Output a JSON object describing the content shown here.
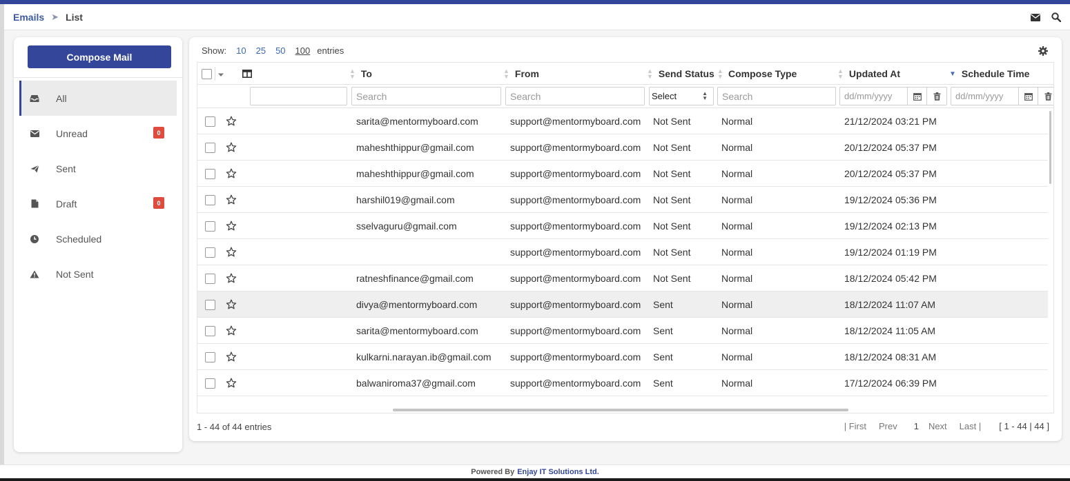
{
  "breadcrumb": {
    "root": "Emails",
    "separator": "➤",
    "current": "List"
  },
  "header_icons": [
    "envelope-icon",
    "search-icon"
  ],
  "sidebar": {
    "compose_label": "Compose Mail",
    "items": [
      {
        "label": "All",
        "icon": "inbox-tray-icon",
        "active": true
      },
      {
        "label": "Unread",
        "icon": "envelope-icon",
        "badge": "0"
      },
      {
        "label": "Sent",
        "icon": "paper-plane-icon"
      },
      {
        "label": "Draft",
        "icon": "document-icon",
        "badge": "0"
      },
      {
        "label": "Scheduled",
        "icon": "clock-icon"
      },
      {
        "label": "Not Sent",
        "icon": "warning-triangle-icon"
      }
    ]
  },
  "list": {
    "show_label": "Show:",
    "page_sizes": [
      "10",
      "25",
      "50",
      "100"
    ],
    "selected_page_size": "100",
    "entries_label": "entries",
    "columns": [
      "To",
      "From",
      "Send Status",
      "Compose Type",
      "Updated At",
      "Schedule Time"
    ],
    "filters": {
      "search_placeholder": "Search",
      "select_value": "Select",
      "date_placeholder": "dd/mm/yyyy"
    },
    "rows": [
      {
        "to": "sarita@mentormyboard.com",
        "from": "support@mentormyboard.com",
        "status": "Not Sent",
        "type": "Normal",
        "updated": "21/12/2024 03:21 PM"
      },
      {
        "to": "maheshthippur@gmail.com",
        "from": "support@mentormyboard.com",
        "status": "Not Sent",
        "type": "Normal",
        "updated": "20/12/2024 05:37 PM"
      },
      {
        "to": "maheshthippur@gmail.com",
        "from": "support@mentormyboard.com",
        "status": "Not Sent",
        "type": "Normal",
        "updated": "20/12/2024 05:37 PM"
      },
      {
        "to": "harshil019@gmail.com",
        "from": "support@mentormyboard.com",
        "status": "Not Sent",
        "type": "Normal",
        "updated": "19/12/2024 05:36 PM"
      },
      {
        "to": "sselvaguru@gmail.com",
        "from": "support@mentormyboard.com",
        "status": "Not Sent",
        "type": "Normal",
        "updated": "19/12/2024 02:13 PM"
      },
      {
        "to": "",
        "from": "support@mentormyboard.com",
        "status": "Not Sent",
        "type": "Normal",
        "updated": "19/12/2024 01:19 PM"
      },
      {
        "to": "ratneshfinance@gmail.com",
        "from": "support@mentormyboard.com",
        "status": "Not Sent",
        "type": "Normal",
        "updated": "18/12/2024 05:42 PM"
      },
      {
        "to": "divya@mentormyboard.com",
        "from": "support@mentormyboard.com",
        "status": "Sent",
        "type": "Normal",
        "updated": "18/12/2024 11:07 AM",
        "highlight": true
      },
      {
        "to": "sarita@mentormyboard.com",
        "from": "support@mentormyboard.com",
        "status": "Sent",
        "type": "Normal",
        "updated": "18/12/2024 11:05 AM"
      },
      {
        "to": "kulkarni.narayan.ib@gmail.com",
        "from": "support@mentormyboard.com",
        "status": "Sent",
        "type": "Normal",
        "updated": "18/12/2024 08:31 AM"
      },
      {
        "to": "balwaniroma37@gmail.com",
        "from": "support@mentormyboard.com",
        "status": "Sent",
        "type": "Normal",
        "updated": "17/12/2024 06:39 PM"
      }
    ],
    "info": "1 - 44 of 44 entries",
    "pagination": {
      "first": "| First",
      "prev": "Prev",
      "page": "1",
      "next": "Next",
      "last": "Last |",
      "summary": "[ 1 - 44 | 44 ]"
    }
  },
  "footer": {
    "powered_by": "Powered By",
    "company": "Enjay IT Solutions Ltd."
  },
  "colors": {
    "primary": "#34469a",
    "link": "#3b67b8",
    "badge": "#e04b3f"
  }
}
